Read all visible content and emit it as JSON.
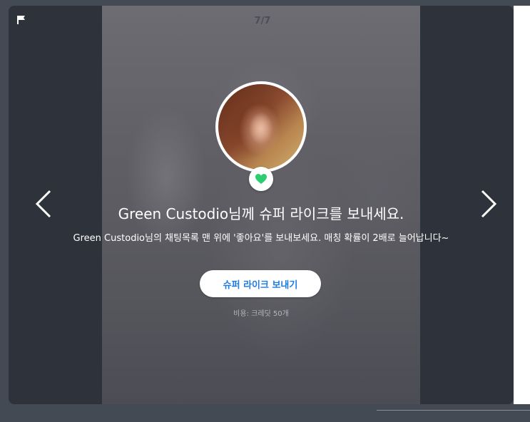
{
  "viewer": {
    "counter": "7/7",
    "title": "Green Custodio님께 슈퍼 라이크를 보내세요.",
    "subtitle": "Green Custodio님의 채팅목록 맨 위에 '좋아요'를 보내보세요. 매칭 확률이 2배로 늘어납니다~",
    "cta_label": "슈퍼 라이크 보내기",
    "cost": "비용: 크레딧 50개"
  },
  "icons": {
    "report": "flag-icon",
    "prev": "chevron-left-icon",
    "next": "chevron-right-icon",
    "like": "heart-icon",
    "avatar": "profile-photo"
  },
  "colors": {
    "panel": "#2e323a",
    "accent_blue": "#1e7be0",
    "heart_green": "#2ecc71",
    "cost_text": "#b4b6bc"
  }
}
